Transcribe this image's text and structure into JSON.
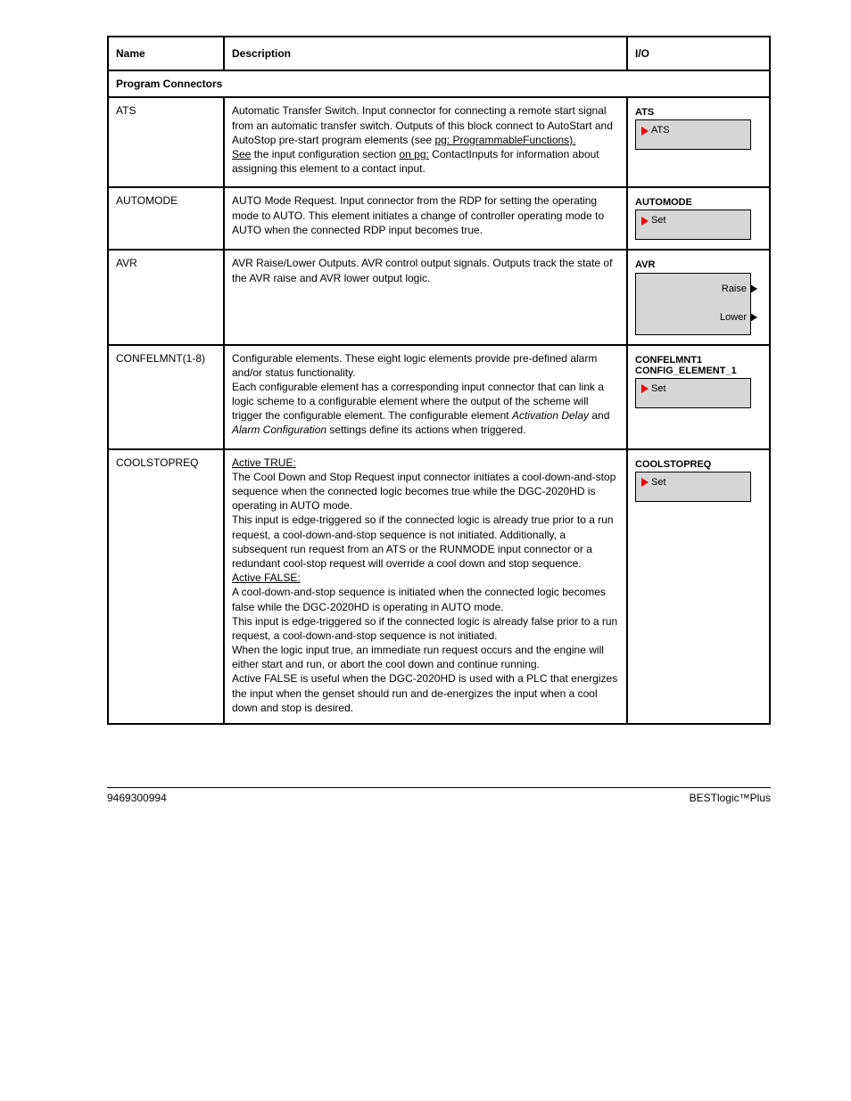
{
  "header": {
    "col1": "Name",
    "col2": "Description",
    "col3": "I/O"
  },
  "section": "Program Connectors",
  "rows": [
    {
      "name": "ATS",
      "desc_html": "Automatic Transfer Switch. Input connector for connecting a remote start signal from an automatic transfer switch. Outputs of this block connect to AutoStart and AutoStop pre-start program elements (see <span class='u'>pg: ProgrammableFunctions).</span><br><span class='u'>See</span> the input configuration section <span class='u'>on pg:</span> ContactInputs for information about assigning this element to a contact input.",
      "icon": {
        "type": "left",
        "title": "ATS",
        "label": "ATS"
      }
    },
    {
      "name": "AUTOMODE",
      "desc_html": "AUTO Mode Request. Input connector from the RDP for setting the operating mode to AUTO. This element initiates a change of controller operating mode to AUTO when the connected RDP input becomes true.",
      "icon": {
        "type": "left",
        "title": "AUTOMODE",
        "label": "Set"
      }
    },
    {
      "name": "AVR",
      "desc_html": "AVR Raise/Lower Outputs. AVR control output signals. Outputs track the state of the AVR raise and AVR lower output logic.",
      "icon": {
        "type": "rightpair",
        "title": "AVR",
        "labels": [
          "Raise",
          "Lower"
        ]
      }
    },
    {
      "name": "CONFELMNT(1-8)",
      "desc_html": "Configurable elements. These eight logic elements provide pre-defined alarm and/or status functionality.<br>Each configurable element has a corresponding input connector that can link a logic scheme to a configurable element where the output of the scheme will trigger the configurable element. The configurable element <em>Activation Delay</em> and <em>Alarm Configuration</em> settings define its actions when triggered.",
      "icon": {
        "type": "left",
        "title": "CONFELMNT1<br>CONFIG_ELEMENT_1",
        "label": "Set"
      }
    },
    {
      "name": "COOLSTOPREQ",
      "desc_html": "<span class='u'>Active TRUE:</span><br>The Cool Down and Stop Request input connector initiates a cool-down-and-stop sequence when the connected logic becomes true while the DGC-2020HD is operating in AUTO mode.<br>This input is edge-triggered so if the connected logic is already true prior to a run request, a cool-down-and-stop sequence is not initiated. Additionally, a subsequent run request from an ATS or the RUNMODE input connector or a redundant cool-stop request will override a cool down and stop sequence.<br><span class='u'>Active FALSE:</span><br>A cool-down-and-stop sequence is initiated when the connected logic becomes false while the DGC-2020HD is operating in AUTO mode.<br>This input is edge-triggered so if the connected logic is already false prior to a run request, a cool-down-and-stop sequence is not initiated.<br>When the logic input true, an immediate run request occurs and the engine will either start and run, or abort the cool down and continue running.<br>Active FALSE is useful when the DGC-2020HD is used with a PLC that energizes the input when the genset should run and de-energizes the input when a cool down and stop is desired.",
      "icon": {
        "type": "left",
        "title": "COOLSTOPREQ",
        "label": "Set"
      }
    }
  ],
  "footer": {
    "left": "9469300994",
    "right": "BESTlogic™Plus"
  }
}
